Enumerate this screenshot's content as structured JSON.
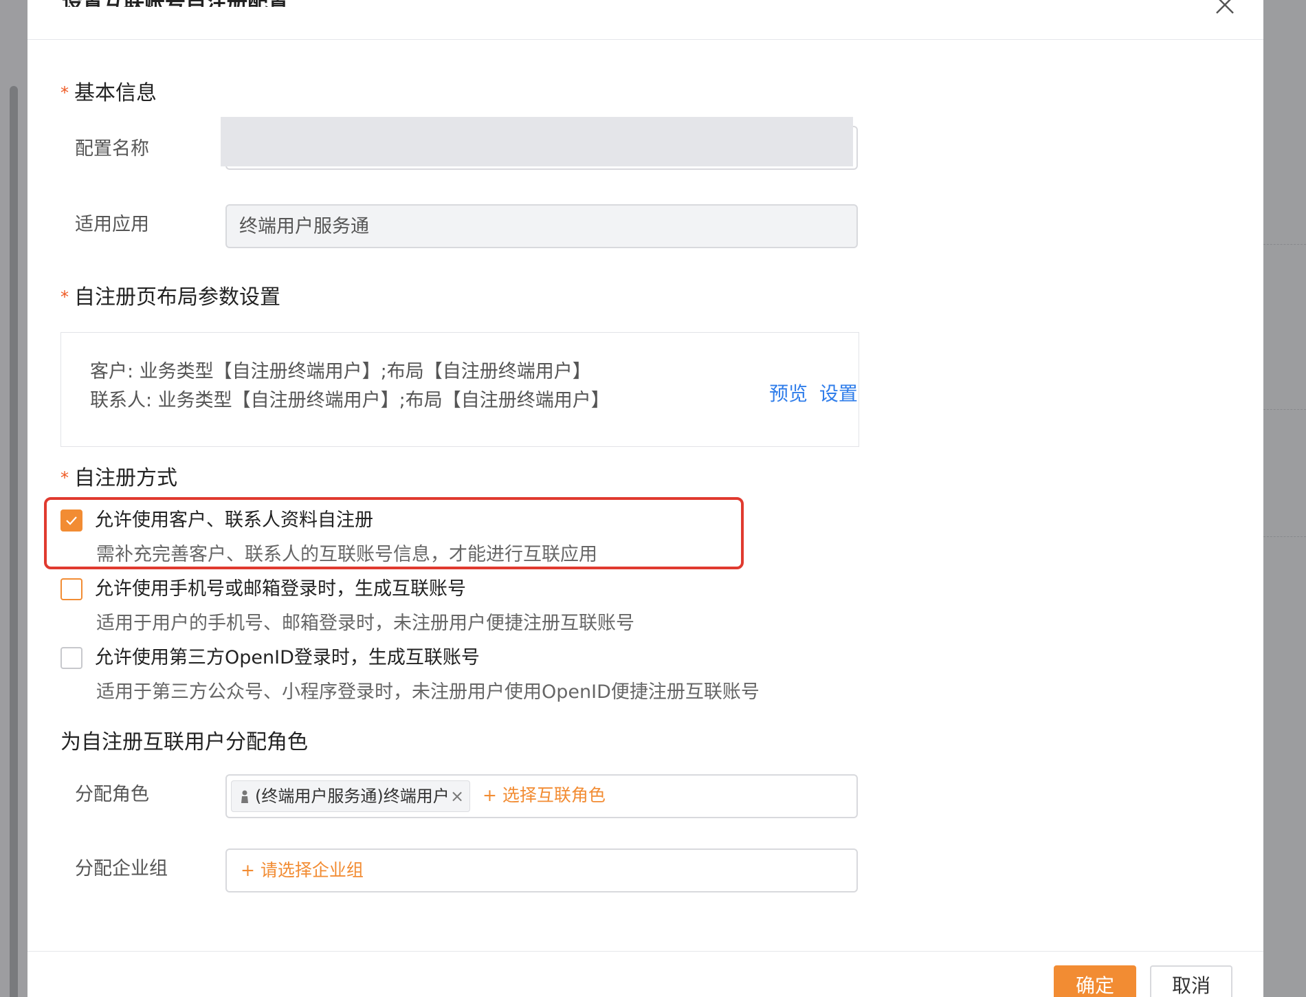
{
  "dialog": {
    "title": "设置互联账号自注册配置"
  },
  "basic_info": {
    "section_title": "基本信息",
    "config_name_label": "配置名称",
    "config_name_value": "",
    "app_label": "适用应用",
    "app_value": "终端用户服务通"
  },
  "layout_settings": {
    "section_title": "自注册页布局参数设置",
    "line1": "客户: 业务类型【自注册终端用户】;布局【自注册终端用户】",
    "line2": "联系人: 业务类型【自注册终端用户】;布局【自注册终端用户】",
    "preview_link": "预览",
    "settings_link": "设置"
  },
  "registration_methods": {
    "section_title": "自注册方式",
    "options": [
      {
        "label": "允许使用客户、联系人资料自注册",
        "desc": "需补充完善客户、联系人的互联账号信息，才能进行互联应用",
        "checked": true
      },
      {
        "label": "允许使用手机号或邮箱登录时，生成互联账号",
        "desc": "适用于用户的手机号、邮箱登录时，未注册用户便捷注册互联账号",
        "checked": false
      },
      {
        "label": "允许使用第三方OpenID登录时，生成互联账号",
        "desc": "适用于第三方公众号、小程序登录时，未注册用户使用OpenID便捷注册互联账号",
        "checked": false
      }
    ]
  },
  "roles": {
    "section_title": "为自注册互联用户分配角色",
    "assign_role_label": "分配角色",
    "role_tag": "(终端用户服务通)终端用户",
    "tag_close": "×",
    "add_role_link": "+ 选择互联角色",
    "assign_group_label": "分配企业组",
    "add_group_link": "+ 请选择企业组"
  },
  "footer": {
    "ok_label": "确定",
    "cancel_label": "取消"
  },
  "colors": {
    "accent": "#f28c33",
    "link": "#2f7dea",
    "required": "#ee5a24",
    "highlight": "#e03a2f"
  }
}
